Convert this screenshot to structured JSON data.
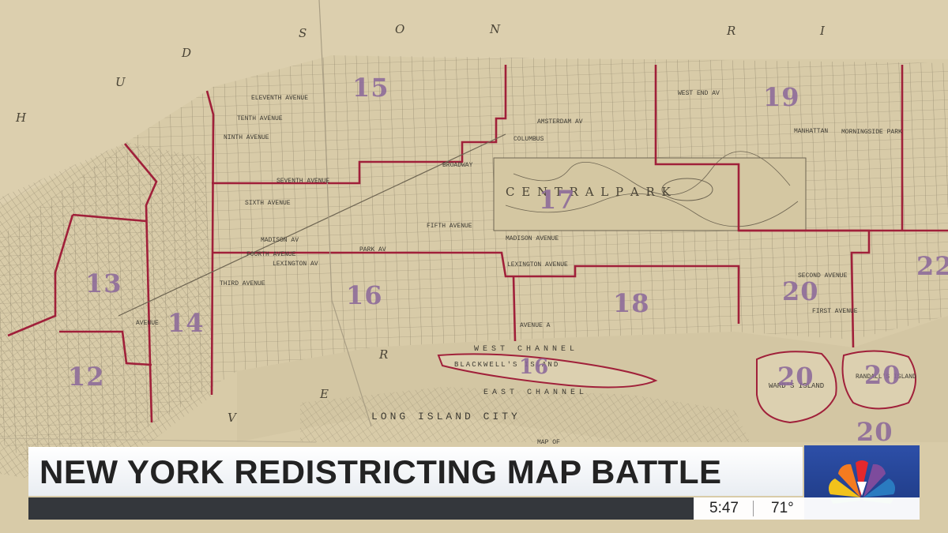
{
  "map": {
    "water_labels": [
      "H",
      "U",
      "D",
      "S",
      "O",
      "N",
      "R",
      "I",
      "V",
      "E",
      "R"
    ],
    "districts": [
      "12",
      "13",
      "14",
      "15",
      "16",
      "17",
      "18",
      "19",
      "20",
      "20",
      "20",
      "20",
      "22"
    ],
    "landmarks": {
      "central_park": "C E N T R A L   P A R K",
      "west_channel": "WEST CHANNEL",
      "east_channel": "EAST CHANNEL",
      "wards_island": "WARD'S ISLAND",
      "randalls_island": "RANDALL'S ISLAND",
      "long_island_city": "LONG ISLAND CITY",
      "blackwells_island": "BLACKWELL'S ISLAND",
      "map_of": "MAP OF"
    },
    "streets": [
      "ELEVENTH AVENUE",
      "TENTH AVENUE",
      "NINTH AVENUE",
      "SEVENTH AVENUE",
      "SIXTH AVENUE",
      "BROADWAY",
      "FIFTH AVENUE",
      "MADISON AV",
      "FOURTH AVENUE",
      "LEXINGTON AV",
      "PARK AV",
      "THIRD AVENUE",
      "SECOND AVENUE",
      "FIRST AVENUE",
      "AVENUE A",
      "WEST END AV",
      "AMSTERDAM AV",
      "COLUMBUS",
      "MANHATTAN",
      "MORNINGSIDE PARK",
      "MADISON AVENUE",
      "LEXINGTON AVENUE",
      "AVENUE"
    ],
    "colors": {
      "paper": "#d8cba8",
      "lines": "#8a8068",
      "district_border": "#a0203a",
      "number_ink": "#8e6c9a",
      "water": "#cfc4a6"
    }
  },
  "banner": {
    "headline": "NEW YORK REDISTRICTING MAP BATTLE",
    "time": "5:47",
    "temperature": "71°",
    "logo": "nbc-peacock-icon"
  }
}
